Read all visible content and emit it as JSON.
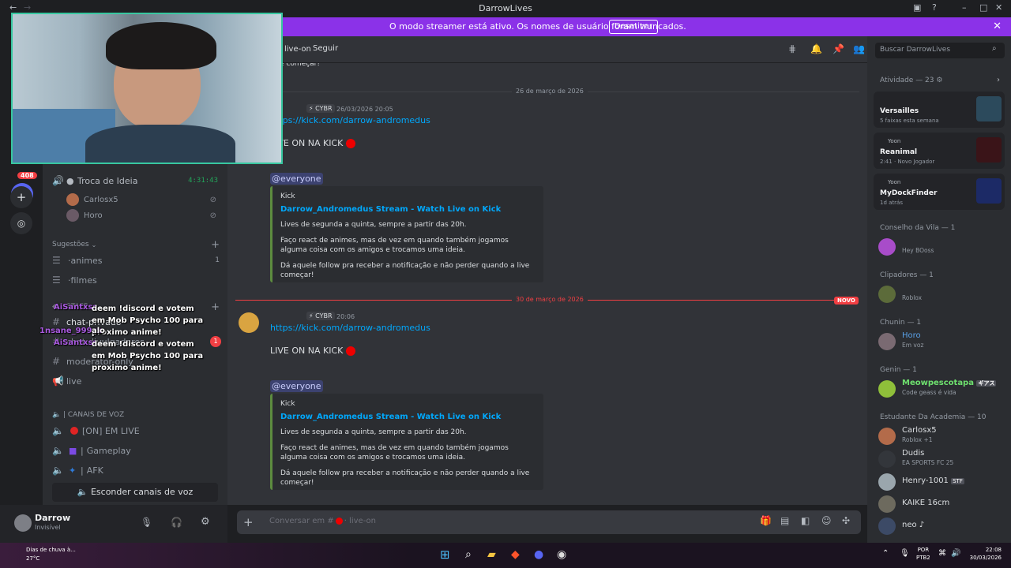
{
  "window": {
    "title": "DarrowLives",
    "back": "←",
    "forward": "→"
  },
  "banner": {
    "message": "O modo streamer está ativo. Os nomes de usuário foram truncados.",
    "button": "Desativar",
    "close": "✕"
  },
  "servers": {
    "badge": "408"
  },
  "sidebar": {
    "voice_active": {
      "name": "Troca de Ideia",
      "timer": "4:31:43",
      "users": [
        "Carlosx5",
        "Horo"
      ]
    },
    "suggestions_label": "Sugestões",
    "text_channels": [
      {
        "name": "animes",
        "count": "1"
      },
      {
        "name": "filmes"
      }
    ],
    "staff_label": "STAFF",
    "staff_channels": [
      {
        "name": "chat-privado"
      },
      {
        "name": "chat-divulgadores",
        "badge": "1"
      },
      {
        "name": "moderator-only"
      },
      {
        "name": "live"
      }
    ],
    "voice_category": "| CANAIS DE VOZ",
    "voice_channels": [
      {
        "name": "[ON] EM LIVE",
        "icon_color": "#e02424"
      },
      {
        "name": "Gameplay",
        "icon_color": "#7b4ae3"
      },
      {
        "name": "AFK",
        "icon_color": "#2f7bd8"
      }
    ],
    "hide_voice": "Esconder canais de voz"
  },
  "user": {
    "name": "Darrow",
    "status": "Invisível"
  },
  "chat": {
    "channel_name": "live-on",
    "follow_label": "Seguir",
    "prev_tail": "e começar!",
    "day1": "26 de março de 2026",
    "day2": "30 de março de 2026",
    "new_label": "NOVO",
    "messages": [
      {
        "tag": "CYBR",
        "time": "26/03/2026 20:05",
        "link": "https://kick.com/darrow-andromedus",
        "text": "LIVE ON NA KICK",
        "mention": "@everyone",
        "embed": {
          "provider": "Kick",
          "title": "Darrow_Andromedus Stream - Watch Live on Kick",
          "desc1": "Lives de segunda a quinta, sempre a partir das 20h.",
          "desc2": "Faço react de animes, mas de vez em quando também jogamos alguma coisa com os amigos e trocamos uma ideia.",
          "desc3": "Dá aquele follow pra receber a notificação e não perder quando a live começar!"
        }
      },
      {
        "tag": "CYBR",
        "time": "20:06",
        "link": "https://kick.com/darrow-andromedus",
        "text": "LIVE ON NA KICK",
        "mention": "@everyone",
        "embed": {
          "provider": "Kick",
          "title": "Darrow_Andromedus Stream - Watch Live on Kick",
          "desc1": "Lives de segunda a quinta, sempre a partir das 20h.",
          "desc2": "Faço react de animes, mas de vez em quando também jogamos alguma coisa com os amigos e trocamos uma ideia.",
          "desc3": "Dá aquele follow pra receber a notificação e não perder quando a live começar!"
        }
      }
    ],
    "composer_placeholder": "Conversar em #",
    "composer_channel": "· live-on"
  },
  "members": {
    "search_placeholder": "Buscar DarrowLives",
    "activity_header": "Atividade — 23",
    "activities": [
      {
        "name": "Versailles",
        "detail": "5 faixas esta semana"
      },
      {
        "user": "Yoon",
        "name": "Reanimal",
        "detail": "2:41 · Novo Jogador"
      },
      {
        "user": "Yoon",
        "name": "MyDockFinder",
        "detail": "1d atrás"
      }
    ],
    "groups": [
      {
        "title": "Conselho da Vila — 1",
        "members": [
          {
            "name": "",
            "status": "Hey BOoss"
          }
        ]
      },
      {
        "title": "Clipadores — 1",
        "members": [
          {
            "name": "",
            "status": "Roblox"
          }
        ]
      },
      {
        "title": "Chunin — 1",
        "members": [
          {
            "name": "Horo",
            "status": "Em voz"
          }
        ]
      },
      {
        "title": "Genin — 1",
        "members": [
          {
            "name": "Meowpescotapa",
            "status": "Code geass é vida",
            "tag": "ギアス"
          }
        ]
      },
      {
        "title": "Estudante Da Academia — 10",
        "members": [
          {
            "name": "Carlosx5",
            "status": "Roblox +1"
          },
          {
            "name": "Dudis",
            "status": "EA SPORTS FC 25"
          },
          {
            "name": "Henry-1001",
            "status": "",
            "tag": "STF"
          },
          {
            "name": "KAIKE 16cm",
            "status": ""
          },
          {
            "name": "neo ♪",
            "status": ""
          }
        ]
      }
    ]
  },
  "overlay_chat": [
    {
      "user": "AiSantxss",
      "text": "deem !discord e votem em Mob Psycho 100 para proximo anime!"
    },
    {
      "user": "1nsane_999zx",
      "text": "alo"
    },
    {
      "user": "AiSantxss",
      "text": "deem !discord e votem em Mob Psycho 100 para proximo anime!"
    }
  ],
  "taskbar": {
    "weather": "Dias de chuva à...",
    "temp": "27°C",
    "lang1": "POR",
    "lang2": "PTB2",
    "time": "22:08",
    "date": "30/03/2026"
  }
}
